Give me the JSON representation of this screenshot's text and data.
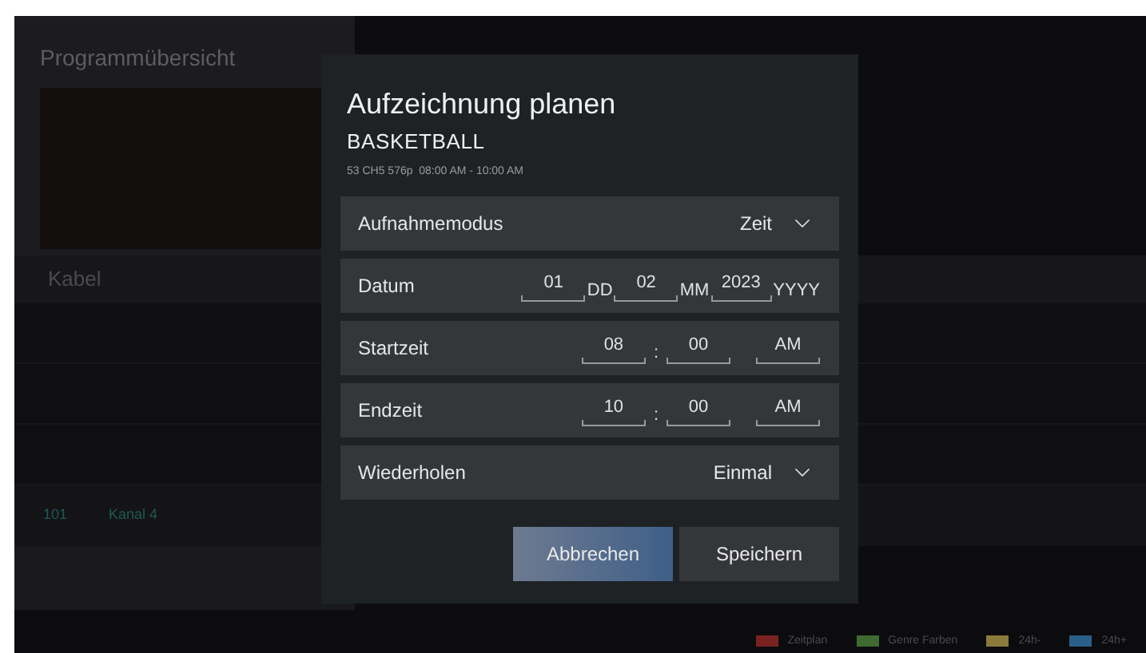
{
  "background": {
    "title": "Programmübersicht",
    "source_label": "Kabel",
    "channel": {
      "number": "101",
      "name": "Kanal 4"
    },
    "legend": [
      {
        "label": "Zeitplan",
        "color": "#7a2222"
      },
      {
        "label": "Genre Farben",
        "color": "#3f6a30"
      },
      {
        "label": "24h-",
        "color": "#8a7a3c"
      },
      {
        "label": "24h+",
        "color": "#2a5f88"
      }
    ]
  },
  "dialog": {
    "title": "Aufzeichnung planen",
    "program": "BASKETBALL",
    "details": "53 CH5 576p  08:00 AM - 10:00 AM",
    "rows": [
      {
        "kind": "select",
        "label": "Aufnahmemodus",
        "value": "Zeit"
      },
      {
        "kind": "date",
        "label": "Datum",
        "fields": [
          {
            "value": "01",
            "unit": "DD"
          },
          {
            "value": "02",
            "unit": "MM"
          },
          {
            "value": "2023",
            "unit": "YYYY"
          }
        ]
      },
      {
        "kind": "time",
        "label": "Startzeit",
        "separator": ":",
        "fields": [
          {
            "value": "08"
          },
          {
            "value": "00"
          },
          {
            "value": "AM"
          }
        ]
      },
      {
        "kind": "time",
        "label": "Endzeit",
        "separator": ":",
        "fields": [
          {
            "value": "10"
          },
          {
            "value": "00"
          },
          {
            "value": "AM"
          }
        ]
      },
      {
        "kind": "select",
        "label": "Wiederholen",
        "value": "Einmal"
      }
    ],
    "buttons": [
      {
        "label": "Abbrechen",
        "selected": true
      },
      {
        "label": "Speichern",
        "selected": false
      }
    ]
  }
}
